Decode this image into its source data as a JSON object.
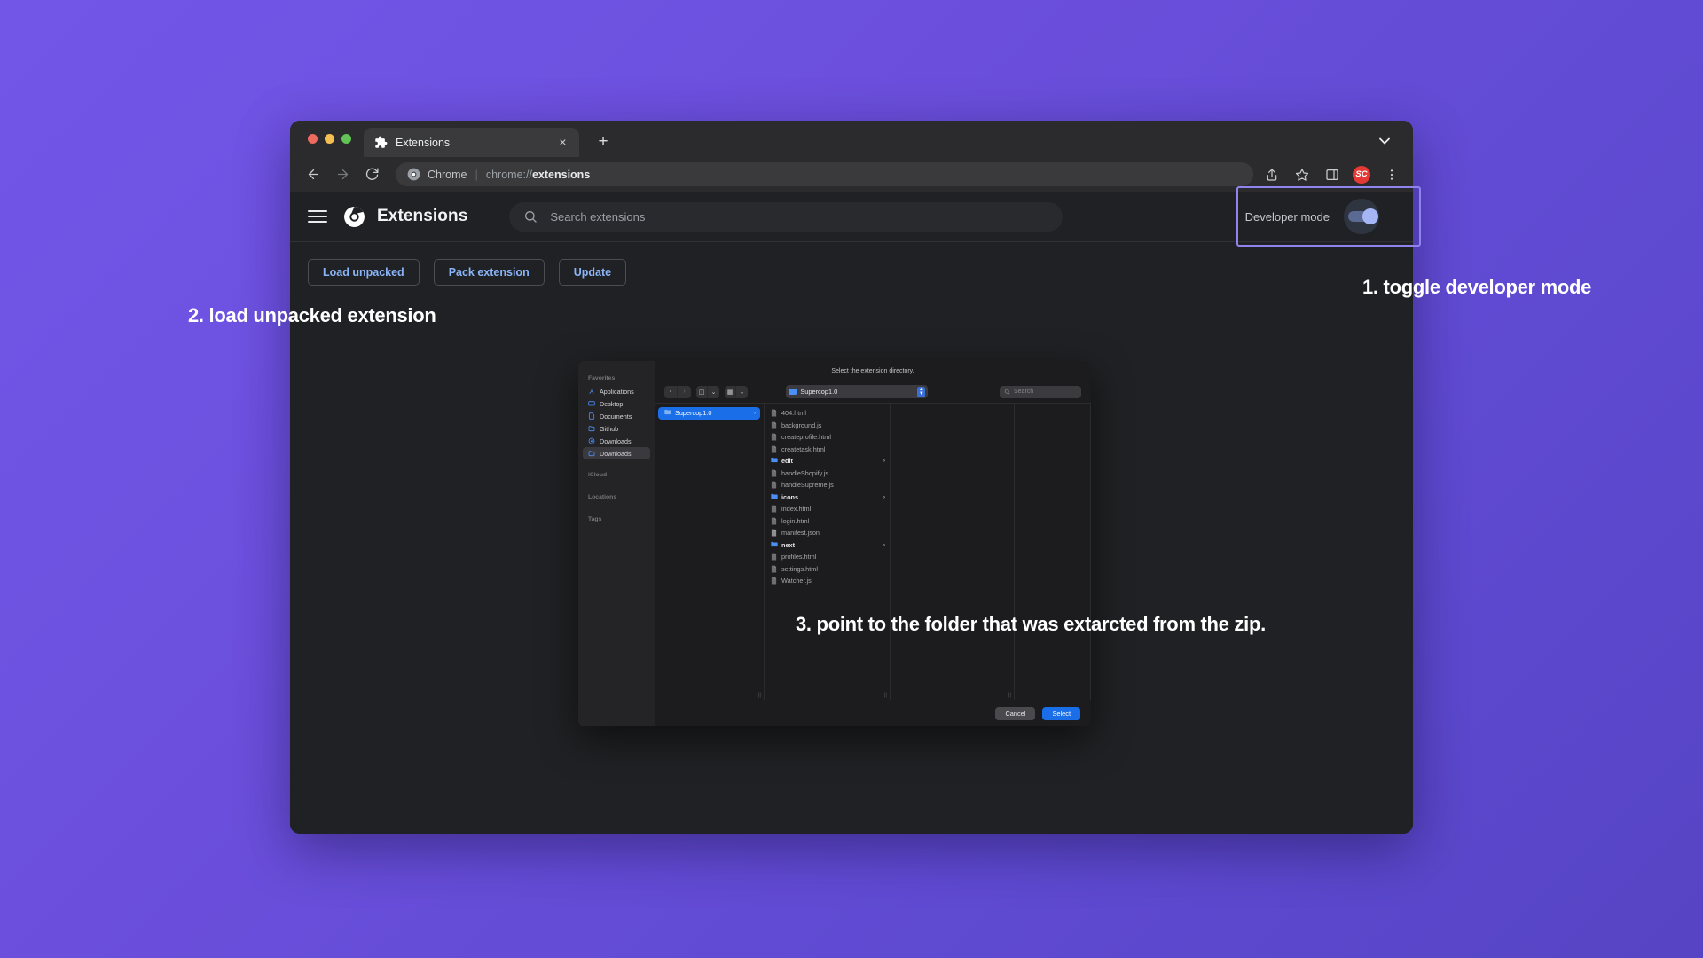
{
  "background": {
    "accent": "#6B4FDC",
    "highlight_border": "#8f84ee"
  },
  "browser": {
    "tab": {
      "title": "Extensions",
      "favicon": "puzzle-piece-icon",
      "close": "×"
    },
    "new_tab_label": "+",
    "omnibox": {
      "chip": "Chrome",
      "url_prefix": "chrome://",
      "url_bold": "extensions"
    },
    "avatar_initials": "SC"
  },
  "extensions_page": {
    "title": "Extensions",
    "search_placeholder": "Search extensions",
    "developer_mode_label": "Developer mode",
    "developer_mode_on": true,
    "actions": [
      {
        "label": "Load unpacked"
      },
      {
        "label": "Pack extension"
      },
      {
        "label": "Update"
      }
    ]
  },
  "file_dialog": {
    "title": "Select the extension directory.",
    "path_value": "Supercop1.0",
    "search_placeholder": "Search",
    "sidebar": {
      "sections": [
        {
          "header": "Favorites",
          "items": [
            {
              "label": "Applications",
              "icon": "applications-icon"
            },
            {
              "label": "Desktop",
              "icon": "desktop-icon"
            },
            {
              "label": "Documents",
              "icon": "documents-icon"
            },
            {
              "label": "Github",
              "icon": "folder-icon"
            },
            {
              "label": "Downloads",
              "icon": "downloads-icon"
            },
            {
              "label": "Downloads",
              "icon": "folder-icon",
              "selected": true
            }
          ]
        },
        {
          "header": "iCloud",
          "items": []
        },
        {
          "header": "Locations",
          "items": []
        },
        {
          "header": "Tags",
          "items": []
        }
      ]
    },
    "column1": [
      {
        "label": "Supercop1.0",
        "type": "folder",
        "selected": true
      }
    ],
    "column2": [
      {
        "label": "404.html",
        "type": "file"
      },
      {
        "label": "background.js",
        "type": "file"
      },
      {
        "label": "createprofile.html",
        "type": "file"
      },
      {
        "label": "createtask.html",
        "type": "file"
      },
      {
        "label": "edit",
        "type": "folder"
      },
      {
        "label": "handleShopify.js",
        "type": "file"
      },
      {
        "label": "handleSupreme.js",
        "type": "file"
      },
      {
        "label": "icons",
        "type": "folder"
      },
      {
        "label": "index.html",
        "type": "file"
      },
      {
        "label": "login.html",
        "type": "file"
      },
      {
        "label": "manifest.json",
        "type": "file"
      },
      {
        "label": "next",
        "type": "folder"
      },
      {
        "label": "profiles.html",
        "type": "file"
      },
      {
        "label": "settings.html",
        "type": "file"
      },
      {
        "label": "Watcher.js",
        "type": "file"
      }
    ],
    "buttons": {
      "cancel": "Cancel",
      "select": "Select"
    }
  },
  "annotations": {
    "step1": "1. toggle developer mode",
    "step2": "2. load unpacked extension",
    "step3": "3. point to the folder that was extarcted from the zip."
  }
}
